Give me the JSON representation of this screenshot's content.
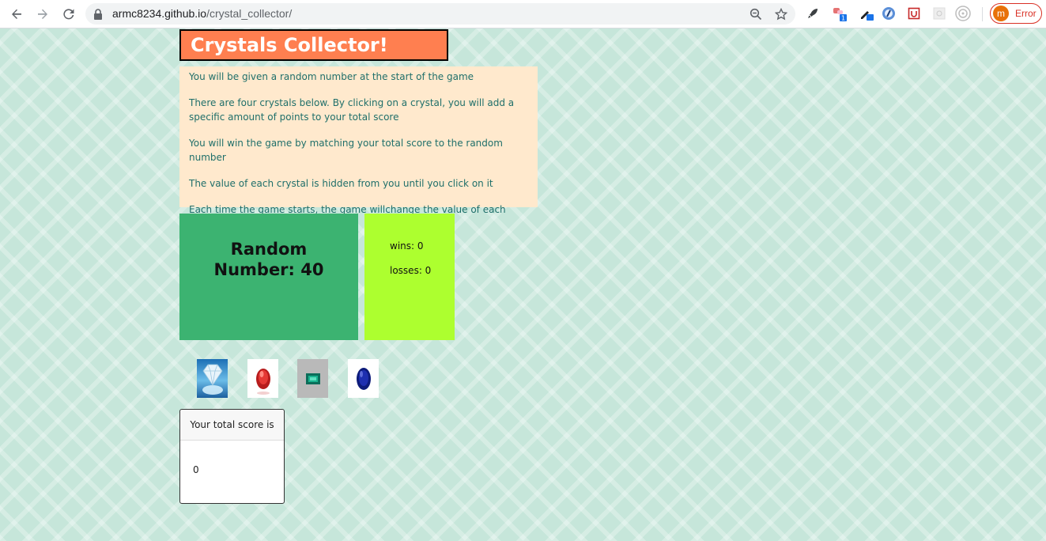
{
  "browser": {
    "url_host": "armc8234.github.io",
    "url_path": "/crystal_collector/",
    "profile_initial": "m",
    "profile_status": "Error"
  },
  "page": {
    "title": "Crystals Collector!",
    "instructions": [
      "You will be given a random number at the start of the game",
      "There are four crystals below. By clicking on a crystal, you will add a specific amount of points to your total score",
      "You will win the game by matching your total score to the random number",
      "The value of each crystal is hidden from you until you click on it",
      "Each time the game starts, the game willchange the value of each crystal"
    ],
    "random_label": "Random Number: 40",
    "wins_label": "wins: 0",
    "losses_label": "losses: 0",
    "crystals": [
      "diamond",
      "ruby",
      "emerald",
      "sapphire"
    ],
    "score_header": "Your total score is",
    "score_value": "0"
  },
  "colors": {
    "background": "#c6e6da",
    "title_bg": "#ff7f50",
    "instructions_bg": "#ffe9cd",
    "instructions_text": "#1f6f6a",
    "random_bg": "#3cb371",
    "stats_bg": "#adff2f"
  }
}
